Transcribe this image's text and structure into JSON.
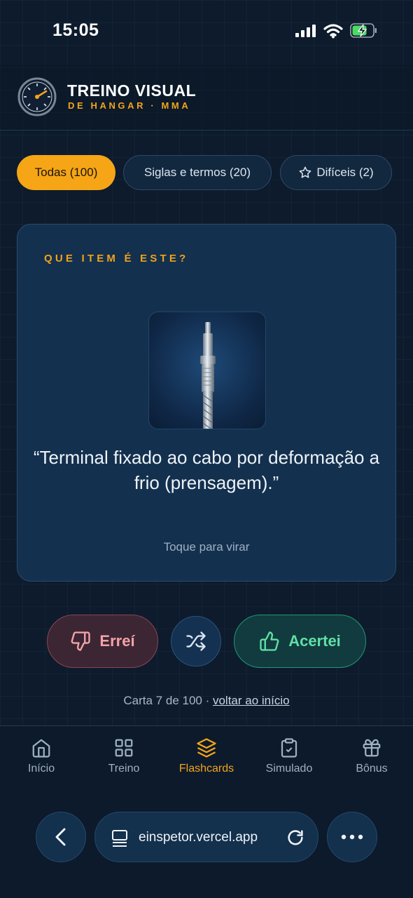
{
  "status_bar": {
    "time": "15:05"
  },
  "header": {
    "title": "TREINO VISUAL",
    "subtitle": "DE HANGAR · MMA"
  },
  "filters": [
    {
      "label": "Todas (100)",
      "active": true
    },
    {
      "label": "Siglas e termos (20)",
      "active": false
    },
    {
      "label": "Difíceis (2)",
      "active": false,
      "icon": "star-icon"
    }
  ],
  "card": {
    "kicker": "QUE ITEM É ESTE?",
    "image_icon": "swaged-cable-terminal",
    "definition": "“Terminal fixado ao cabo por deformação a frio (prensagem).”",
    "hint": "Toque para virar"
  },
  "actions": {
    "wrong_label": "Erreí",
    "right_label": "Acertei",
    "shuffle_icon": "shuffle-icon"
  },
  "progress": {
    "text": "Carta 7 de 100 · ",
    "link": "voltar ao início"
  },
  "nav": [
    {
      "label": "Início",
      "icon": "home-icon"
    },
    {
      "label": "Treino",
      "icon": "grid-icon"
    },
    {
      "label": "Flashcards",
      "icon": "layers-icon",
      "active": true
    },
    {
      "label": "Simulado",
      "icon": "clipboard-icon"
    },
    {
      "label": "Bônus",
      "icon": "gift-icon"
    }
  ],
  "browser": {
    "url": "einspetor.vercel.app"
  },
  "colors": {
    "accent": "#f5a516",
    "wrong": "#f3a3a9",
    "right": "#5fe0a6",
    "background": "#0d1b2c"
  }
}
